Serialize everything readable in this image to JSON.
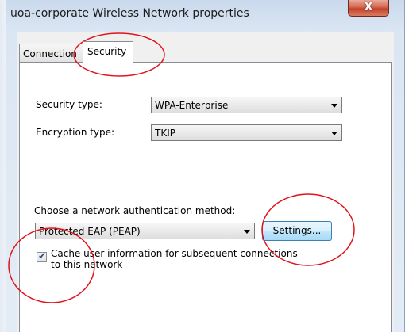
{
  "window": {
    "title": "uoa-corporate Wireless Network properties",
    "close_glyph": "X"
  },
  "tabs": [
    {
      "label": "Connection",
      "selected": false
    },
    {
      "label": "Security",
      "selected": true
    }
  ],
  "security": {
    "security_type_label": "Security type:",
    "security_type_value": "WPA-Enterprise",
    "encryption_type_label": "Encryption type:",
    "encryption_type_value": "TKIP",
    "auth_method_label": "Choose a network authentication method:",
    "auth_method_value": "Protected EAP (PEAP)",
    "settings_button": "Settings...",
    "cache_checkbox_line1": "Cache user information for subsequent connections",
    "cache_checkbox_line2": "to this network",
    "cache_checked": true
  },
  "colors": {
    "annotation_circle": "#e0141a",
    "close_button": "#c4432c",
    "selected_tab": "#ffffff"
  },
  "icons": {
    "close": "close-icon",
    "dropdown": "chevron-down-icon",
    "check": "checkmark-icon"
  }
}
